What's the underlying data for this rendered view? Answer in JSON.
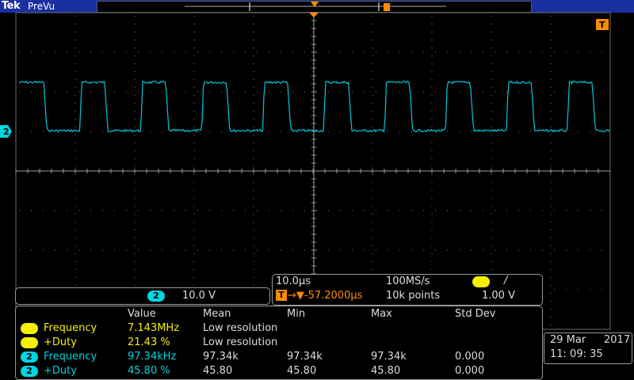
{
  "header": {
    "brand": "Tek",
    "status": "PreVu"
  },
  "markers": {
    "channel": "2",
    "trigger": "T"
  },
  "channel_panel": {
    "channel": "2",
    "scale": "10.0 V"
  },
  "horizontal": {
    "time_div": "10.0µs",
    "sample_rate": "100MS/s",
    "trigger_source": "1",
    "trigger_slope": "/",
    "trigger_position": "→▼-57.2000µs",
    "record_length": "10k points",
    "trigger_level": "1.00 V"
  },
  "measurements": {
    "headers": [
      "Value",
      "Mean",
      "Min",
      "Max",
      "Std Dev"
    ],
    "rows": [
      {
        "channel": "1",
        "name": "Frequency",
        "value": "7.143MHz",
        "mean": "Low resolution",
        "min": "",
        "max": "",
        "std": ""
      },
      {
        "channel": "1",
        "name": "+Duty",
        "value": "21.43 %",
        "mean": "Low resolution",
        "min": "",
        "max": "",
        "std": ""
      },
      {
        "channel": "2",
        "name": "Frequency",
        "value": "97.34kHz",
        "mean": "97.34k",
        "min": "97.34k",
        "max": "97.34k",
        "std": "0.000"
      },
      {
        "channel": "2",
        "name": "+Duty",
        "value": "45.80 %",
        "mean": "45.80",
        "min": "45.80",
        "max": "45.80",
        "std": "0.000"
      }
    ]
  },
  "clock": {
    "date": "29 Mar",
    "year": "2017",
    "time": "11: 09: 35"
  },
  "colors": {
    "ch1": "#f5f000",
    "ch2": "#00d5e0",
    "topbar": "#1a2fa0"
  }
}
